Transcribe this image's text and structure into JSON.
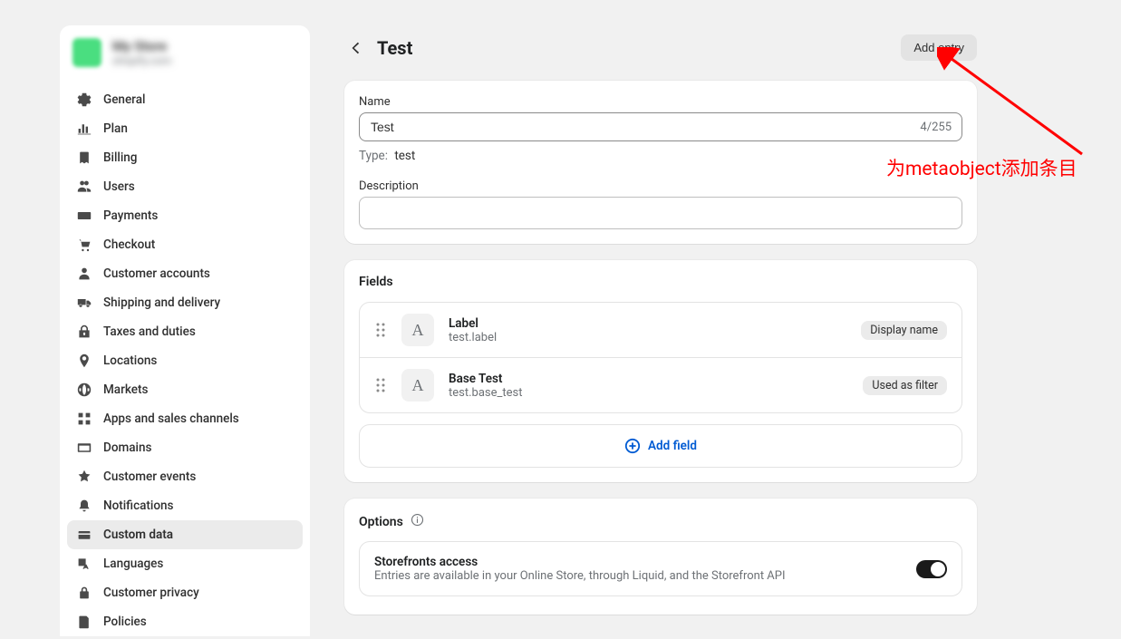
{
  "store": {
    "name": "My Store",
    "subtitle": "shopify.com"
  },
  "sidebar": {
    "items": [
      {
        "label": "General",
        "icon": "gear-icon",
        "active": false
      },
      {
        "label": "Plan",
        "icon": "plan-icon",
        "active": false
      },
      {
        "label": "Billing",
        "icon": "billing-icon",
        "active": false
      },
      {
        "label": "Users",
        "icon": "users-icon",
        "active": false
      },
      {
        "label": "Payments",
        "icon": "payments-icon",
        "active": false
      },
      {
        "label": "Checkout",
        "icon": "checkout-icon",
        "active": false
      },
      {
        "label": "Customer accounts",
        "icon": "customer-accounts-icon",
        "active": false
      },
      {
        "label": "Shipping and delivery",
        "icon": "shipping-icon",
        "active": false
      },
      {
        "label": "Taxes and duties",
        "icon": "taxes-icon",
        "active": false
      },
      {
        "label": "Locations",
        "icon": "locations-icon",
        "active": false
      },
      {
        "label": "Markets",
        "icon": "markets-icon",
        "active": false
      },
      {
        "label": "Apps and sales channels",
        "icon": "apps-icon",
        "active": false
      },
      {
        "label": "Domains",
        "icon": "domains-icon",
        "active": false
      },
      {
        "label": "Customer events",
        "icon": "customer-events-icon",
        "active": false
      },
      {
        "label": "Notifications",
        "icon": "notifications-icon",
        "active": false
      },
      {
        "label": "Custom data",
        "icon": "custom-data-icon",
        "active": true
      },
      {
        "label": "Languages",
        "icon": "languages-icon",
        "active": false
      },
      {
        "label": "Customer privacy",
        "icon": "privacy-icon",
        "active": false
      },
      {
        "label": "Policies",
        "icon": "policies-icon",
        "active": false
      }
    ]
  },
  "page": {
    "title": "Test",
    "add_entry_label": "Add entry"
  },
  "definition": {
    "name_label": "Name",
    "name_value": "Test",
    "name_counter": "4/255",
    "type_key_label": "Type:",
    "type_value": "test",
    "description_label": "Description",
    "description_value": ""
  },
  "fields": {
    "section_title": "Fields",
    "items": [
      {
        "name": "Label",
        "key": "test.label",
        "badge": "Display name",
        "type_glyph": "A"
      },
      {
        "name": "Base Test",
        "key": "test.base_test",
        "badge": "Used as filter",
        "type_glyph": "A"
      }
    ],
    "add_field_label": "Add field"
  },
  "options": {
    "section_title": "Options",
    "storefront": {
      "title": "Storefronts access",
      "description": "Entries are available in your Online Store, through Liquid, and the Storefront API",
      "enabled": true
    }
  },
  "annotation": {
    "text": "为metaobject添加条目"
  }
}
